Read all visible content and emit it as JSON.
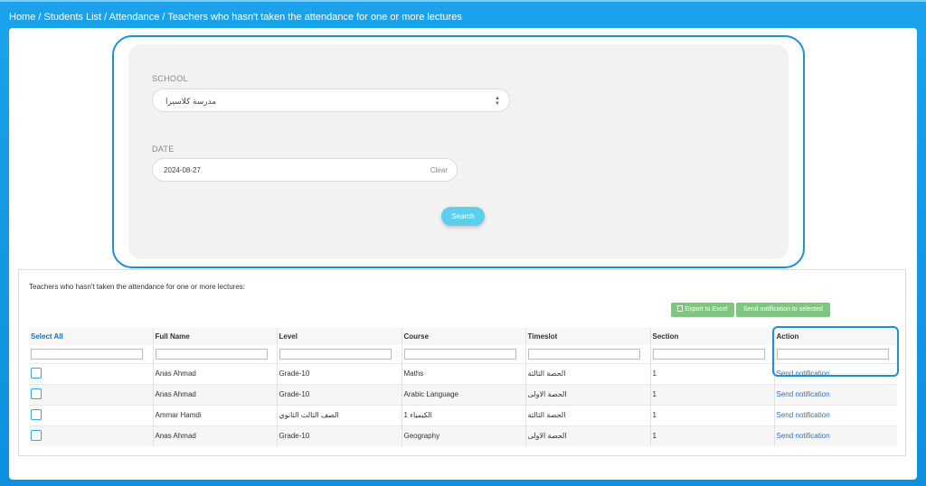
{
  "breadcrumb": {
    "items": [
      "Home",
      "Students List",
      "Attendance",
      "Teachers who hasn't taken the attendance for one or more lectures"
    ]
  },
  "filters": {
    "school_label": "SCHOOL",
    "school_value": "مدرسة كلاسيرا",
    "date_label": "DATE",
    "date_value": "2024-08-27",
    "clear_label": "Clear",
    "search_label": "Search"
  },
  "results": {
    "title": "Teachers who hasn't taken the attendance for one or more lectures:",
    "export_label": "Export to Excel",
    "send_selected_label": "Send notification to selected",
    "columns": [
      "Select All",
      "Full Name",
      "Level",
      "Course",
      "Timeslot",
      "Section",
      "Action"
    ],
    "rows": [
      {
        "name": "Anas Ahmad",
        "level": "Grade-10",
        "course": "Maths",
        "timeslot": "الحصة الثالثة",
        "section": "1",
        "action": "Send notification"
      },
      {
        "name": "Anas Ahmad",
        "level": "Grade-10",
        "course": "Arabic Language",
        "timeslot": "الحصة الاولى",
        "section": "1",
        "action": "Send notification"
      },
      {
        "name": "Ammar Hamdi",
        "level": "الصف الثالث الثانوي",
        "course": "الكيمياء 1",
        "timeslot": "الحصة الثالثة",
        "section": "1",
        "action": "Send notification"
      },
      {
        "name": "Anas Ahmad",
        "level": "Grade-10",
        "course": "Geography",
        "timeslot": "الحصة الاولى",
        "section": "1",
        "action": "Send notification"
      }
    ]
  }
}
